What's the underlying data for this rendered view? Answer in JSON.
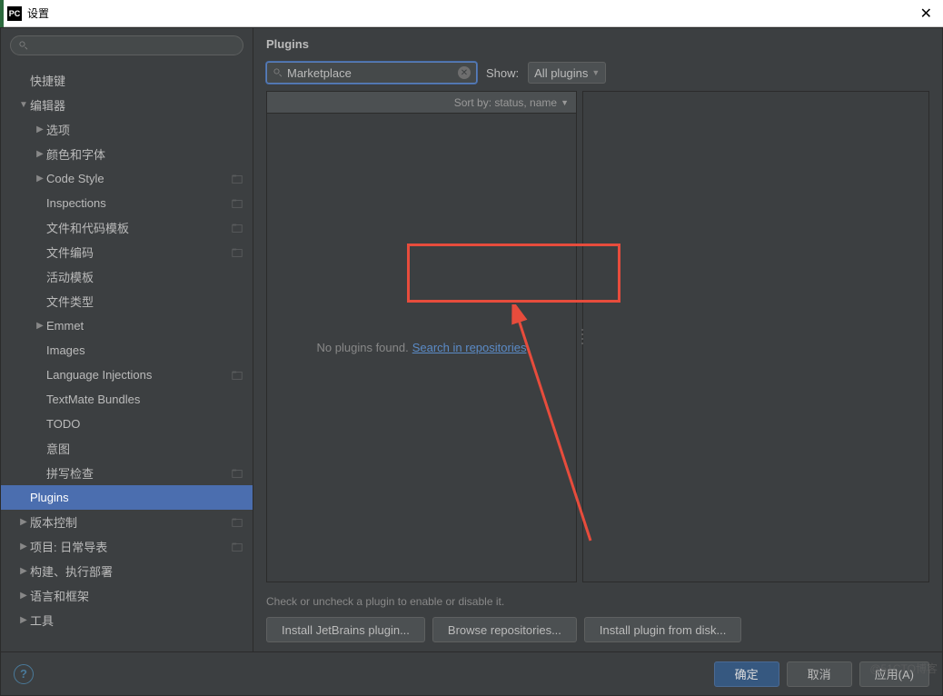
{
  "window": {
    "icon_text": "PC",
    "title": "设置"
  },
  "sidebar": {
    "search_placeholder": "",
    "items": [
      {
        "label": "快捷键",
        "depth": 0,
        "arrow": "",
        "proj": false,
        "selected": false
      },
      {
        "label": "编辑器",
        "depth": 0,
        "arrow": "▼",
        "proj": false,
        "selected": false
      },
      {
        "label": "选项",
        "depth": 1,
        "arrow": "▶",
        "proj": false,
        "selected": false
      },
      {
        "label": "颜色和字体",
        "depth": 1,
        "arrow": "▶",
        "proj": false,
        "selected": false
      },
      {
        "label": "Code Style",
        "depth": 1,
        "arrow": "▶",
        "proj": true,
        "selected": false
      },
      {
        "label": "Inspections",
        "depth": 1,
        "arrow": "",
        "proj": true,
        "selected": false
      },
      {
        "label": "文件和代码模板",
        "depth": 1,
        "arrow": "",
        "proj": true,
        "selected": false
      },
      {
        "label": "文件编码",
        "depth": 1,
        "arrow": "",
        "proj": true,
        "selected": false
      },
      {
        "label": "活动模板",
        "depth": 1,
        "arrow": "",
        "proj": false,
        "selected": false
      },
      {
        "label": "文件类型",
        "depth": 1,
        "arrow": "",
        "proj": false,
        "selected": false
      },
      {
        "label": "Emmet",
        "depth": 1,
        "arrow": "▶",
        "proj": false,
        "selected": false
      },
      {
        "label": "Images",
        "depth": 1,
        "arrow": "",
        "proj": false,
        "selected": false
      },
      {
        "label": "Language Injections",
        "depth": 1,
        "arrow": "",
        "proj": true,
        "selected": false
      },
      {
        "label": "TextMate Bundles",
        "depth": 1,
        "arrow": "",
        "proj": false,
        "selected": false
      },
      {
        "label": "TODO",
        "depth": 1,
        "arrow": "",
        "proj": false,
        "selected": false
      },
      {
        "label": "意图",
        "depth": 1,
        "arrow": "",
        "proj": false,
        "selected": false
      },
      {
        "label": "拼写检查",
        "depth": 1,
        "arrow": "",
        "proj": true,
        "selected": false
      },
      {
        "label": "Plugins",
        "depth": 0,
        "arrow": "",
        "proj": false,
        "selected": true
      },
      {
        "label": "版本控制",
        "depth": 0,
        "arrow": "▶",
        "proj": true,
        "selected": false
      },
      {
        "label": "项目: 日常导表",
        "depth": 0,
        "arrow": "▶",
        "proj": true,
        "selected": false
      },
      {
        "label": "构建、执行部署",
        "depth": 0,
        "arrow": "▶",
        "proj": false,
        "selected": false
      },
      {
        "label": "语言和框架",
        "depth": 0,
        "arrow": "▶",
        "proj": false,
        "selected": false
      },
      {
        "label": "工具",
        "depth": 0,
        "arrow": "▶",
        "proj": false,
        "selected": false
      }
    ]
  },
  "content": {
    "title": "Plugins",
    "search_value": "Marketplace",
    "show_label": "Show:",
    "show_value": "All plugins",
    "sort_label": "Sort by: status, name",
    "empty_text": "No plugins found.",
    "search_repo_link": "Search in repositories",
    "hint": "Check or uncheck a plugin to enable or disable it.",
    "buttons": {
      "install_jb": "Install JetBrains plugin...",
      "browse": "Browse repositories...",
      "from_disk": "Install plugin from disk..."
    }
  },
  "footer": {
    "ok": "确定",
    "cancel": "取消",
    "apply": "应用(A)"
  },
  "watermark": "@51CTO博客"
}
